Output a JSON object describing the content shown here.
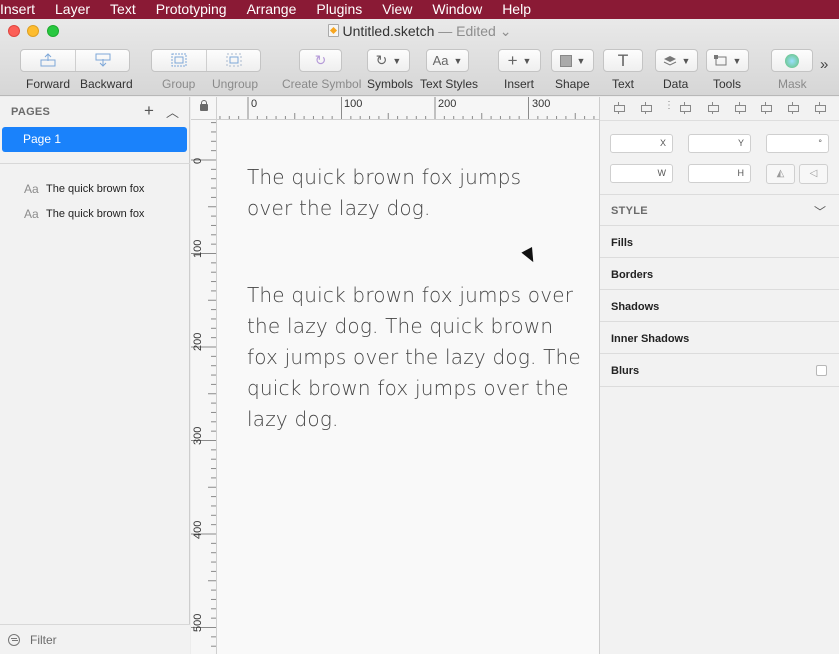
{
  "menubar": {
    "items": [
      "Insert",
      "Layer",
      "Text",
      "Prototyping",
      "Arrange",
      "Plugins",
      "View",
      "Window",
      "Help"
    ]
  },
  "window": {
    "title": "Untitled.sketch",
    "status": "— Edited",
    "status_chevron": "⌄"
  },
  "toolbar": {
    "forward": "Forward",
    "backward": "Backward",
    "group": "Group",
    "ungroup": "Ungroup",
    "create_symbol": "Create Symbol",
    "symbols": "Symbols",
    "text_styles": "Text Styles",
    "text_styles_icon": "Aa",
    "insert": "Insert",
    "shape": "Shape",
    "text": "Text",
    "data": "Data",
    "tools": "Tools",
    "mask": "Mask",
    "overflow": "»"
  },
  "sidebar": {
    "pages_header": "PAGES",
    "pages": [
      {
        "label": "Page 1",
        "selected": true
      }
    ],
    "layers": [
      {
        "icon": "Aa",
        "label": "The quick brown fox"
      },
      {
        "icon": "Aa",
        "label": "The quick brown fox"
      }
    ],
    "filter_label": "Filter"
  },
  "rulers": {
    "top_labels": [
      "0",
      "100",
      "200",
      "300"
    ],
    "left_labels": [
      "0",
      "100",
      "200",
      "300",
      "400",
      "500"
    ]
  },
  "canvas": {
    "text1_lines": [
      "The quick brown fox jumps",
      "over the lazy dog."
    ],
    "text2_lines": [
      "The quick brown fox jumps over",
      "the lazy dog. The quick brown",
      "fox jumps over the lazy dog. The",
      "quick brown fox jumps over the",
      "lazy dog."
    ]
  },
  "inspector": {
    "x_label": "X",
    "y_label": "Y",
    "rotation_label": "°",
    "w_label": "W",
    "h_label": "H",
    "style_header": "STYLE",
    "sections": [
      "Fills",
      "Borders",
      "Shadows",
      "Inner Shadows",
      "Blurs"
    ]
  },
  "colors": {
    "menubar": "#8a1a35",
    "selection": "#1a82fb"
  }
}
